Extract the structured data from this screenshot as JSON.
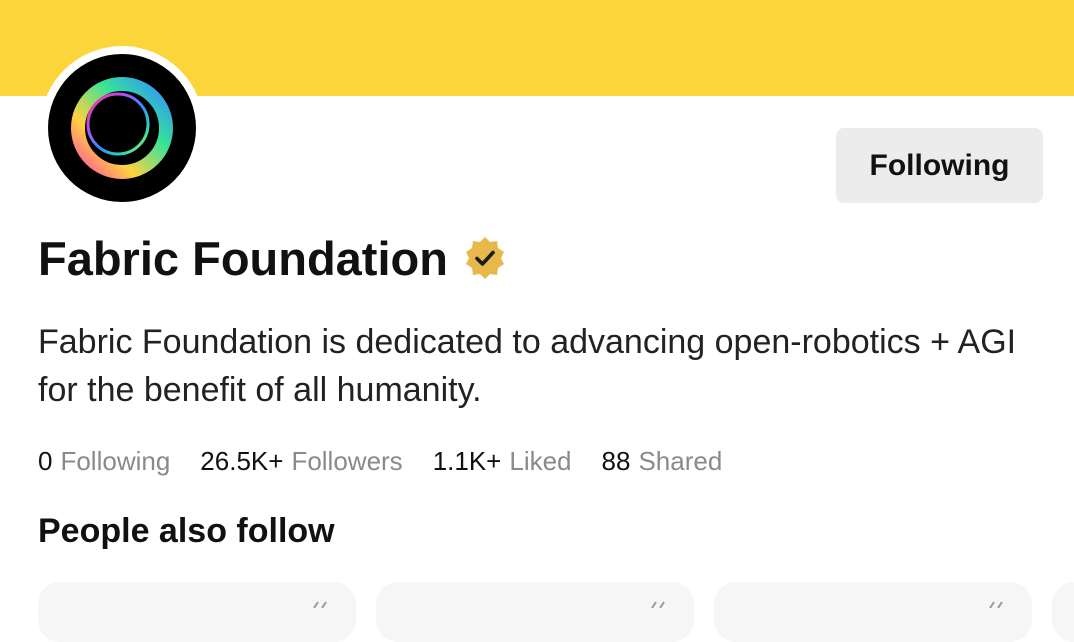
{
  "profile": {
    "name": "Fabric Foundation",
    "bio": "Fabric Foundation is dedicated to advancing open-robotics + AGI for the benefit of all humanity.",
    "verified_icon": "verified-badge-icon",
    "avatar_icon": "fabric-ring-logo"
  },
  "actions": {
    "follow_label": "Following"
  },
  "stats": [
    {
      "value": "0",
      "label": "Following"
    },
    {
      "value": "26.5K+",
      "label": "Followers"
    },
    {
      "value": "1.1K+",
      "label": "Liked"
    },
    {
      "value": "88",
      "label": "Shared"
    }
  ],
  "suggestions": {
    "title": "People also follow",
    "card_count": 3
  },
  "colors": {
    "banner": "#fbd53a",
    "button_bg": "#ececec",
    "badge_gold": "#e8b94a",
    "muted_text": "#8a8a8a"
  }
}
